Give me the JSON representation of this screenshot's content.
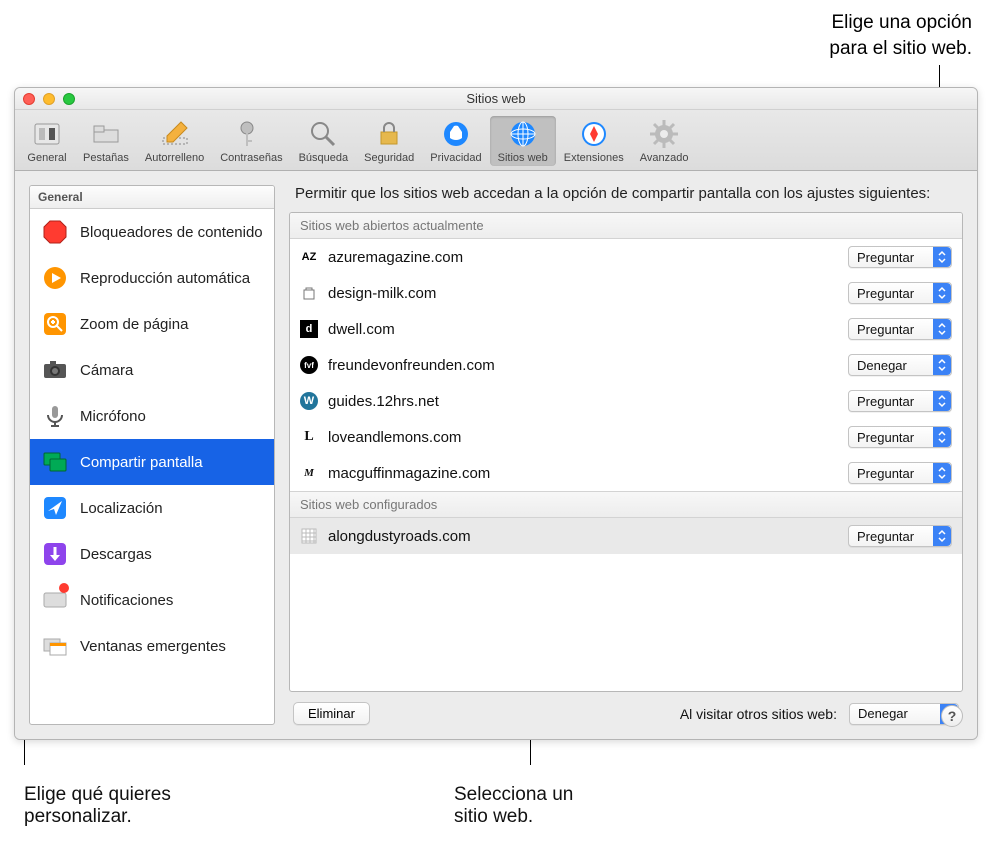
{
  "callouts": {
    "top_right_l1": "Elige una opción",
    "top_right_l2": "para el sitio web.",
    "bottom_left_l1": "Elige qué quieres",
    "bottom_left_l2": "personalizar.",
    "bottom_right_l1": "Selecciona un",
    "bottom_right_l2": "sitio web."
  },
  "window": {
    "title": "Sitios web"
  },
  "toolbar": {
    "items": {
      "general": "General",
      "tabs": "Pestañas",
      "autofill": "Autorrelleno",
      "passwords": "Contraseñas",
      "search": "Búsqueda",
      "security": "Seguridad",
      "privacy": "Privacidad",
      "websites": "Sitios web",
      "extensions": "Extensiones",
      "advanced": "Avanzado"
    }
  },
  "sidebar": {
    "header": "General",
    "items": {
      "content_blockers": "Bloqueadores de contenido",
      "autoplay": "Reproducción automática",
      "page_zoom": "Zoom de página",
      "camera": "Cámara",
      "microphone": "Micrófono",
      "screen_sharing": "Compartir pantalla",
      "location": "Localización",
      "downloads": "Descargas",
      "notifications": "Notificaciones",
      "popups": "Ventanas emergentes"
    }
  },
  "content": {
    "caption": "Permitir que los sitios web accedan a la opción de compartir pantalla con los ajustes siguientes:",
    "section_open": "Sitios web abiertos actualmente",
    "section_configured": "Sitios web configurados",
    "open_sites": [
      {
        "domain": "azuremagazine.com",
        "option": "Preguntar",
        "favicon": "AZ"
      },
      {
        "domain": "design-milk.com",
        "option": "Preguntar",
        "favicon": "bag"
      },
      {
        "domain": "dwell.com",
        "option": "Preguntar",
        "favicon": "d"
      },
      {
        "domain": "freundevonfreunden.com",
        "option": "Denegar",
        "favicon": "fvf"
      },
      {
        "domain": "guides.12hrs.net",
        "option": "Preguntar",
        "favicon": "W"
      },
      {
        "domain": "loveandlemons.com",
        "option": "Preguntar",
        "favicon": "L"
      },
      {
        "domain": "macguffinmagazine.com",
        "option": "Preguntar",
        "favicon": "M"
      }
    ],
    "configured_sites": [
      {
        "domain": "alongdustyroads.com",
        "option": "Preguntar",
        "favicon": "grid"
      }
    ],
    "delete_button": "Eliminar",
    "footer_label": "Al visitar otros sitios web:",
    "footer_option": "Denegar"
  }
}
